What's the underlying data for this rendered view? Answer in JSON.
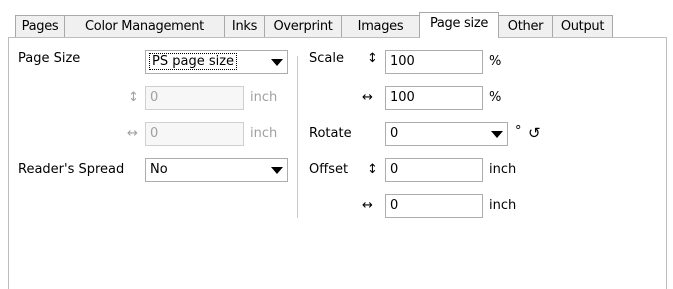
{
  "tabs": [
    {
      "label": "Pages"
    },
    {
      "label": "Color Management"
    },
    {
      "label": "Inks"
    },
    {
      "label": "Overprint"
    },
    {
      "label": "Images"
    },
    {
      "label": "Page size"
    },
    {
      "label": "Other"
    },
    {
      "label": "Output"
    }
  ],
  "active_tab": "Page size",
  "left": {
    "page_size_label": "Page Size",
    "page_size_value": "PS page size",
    "height_icon": "↕",
    "height_value": "0",
    "height_unit": "inch",
    "width_icon": "↔",
    "width_value": "0",
    "width_unit": "inch",
    "readers_spread_label": "Reader's Spread",
    "readers_spread_value": "No"
  },
  "right": {
    "scale_label": "Scale",
    "scale_v_icon": "↕",
    "scale_v_value": "100",
    "scale_v_unit": "%",
    "scale_h_icon": "↔",
    "scale_h_value": "100",
    "scale_h_unit": "%",
    "rotate_label": "Rotate",
    "rotate_value": "0",
    "rotate_unit": "°",
    "rotate_reset_icon": "↺",
    "offset_label": "Offset",
    "offset_v_icon": "↕",
    "offset_v_value": "0",
    "offset_v_unit": "inch",
    "offset_h_icon": "↔",
    "offset_h_value": "0",
    "offset_h_unit": "inch"
  }
}
